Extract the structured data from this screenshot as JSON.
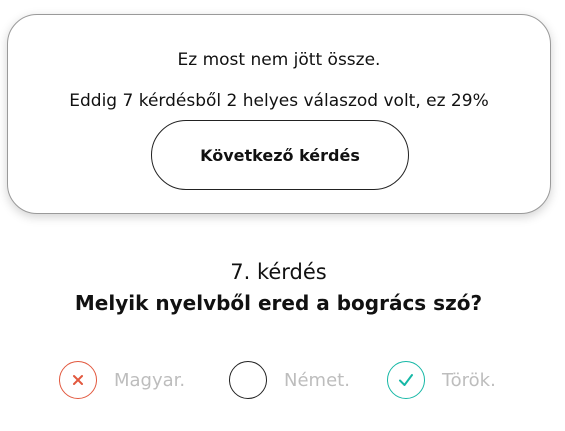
{
  "feedback": {
    "title": "Ez most nem jött össze.",
    "score_text": "Eddig 7 kérdésből 2 helyes válaszod volt, ez 29%",
    "next_button_label": "Következő kérdés"
  },
  "question": {
    "number_label": "7. kérdés",
    "text": "Melyik nyelvből ered a bogrács szó?"
  },
  "answers": [
    {
      "label": "Magyar.",
      "state": "wrong",
      "icon": "x-icon"
    },
    {
      "label": "Német.",
      "state": "neutral",
      "icon": ""
    },
    {
      "label": "Török.",
      "state": "correct",
      "icon": "check-icon"
    }
  ],
  "colors": {
    "wrong": "#e2583e",
    "correct": "#16b8a6",
    "muted_text": "#bdbdbd"
  }
}
